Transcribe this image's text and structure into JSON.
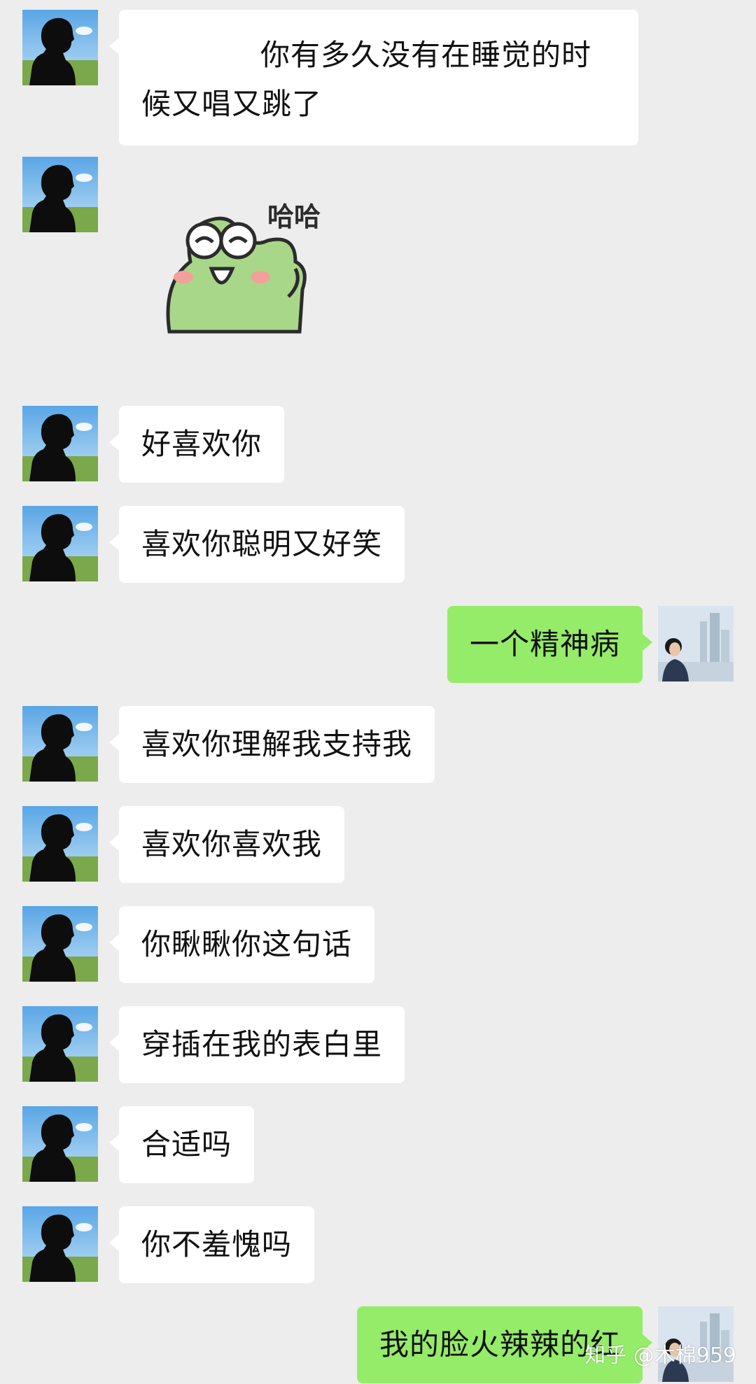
{
  "messages": [
    {
      "side": "in",
      "type": "text",
      "text": "你有多久没有在睡觉的时候又唱又跳了"
    },
    {
      "side": "in",
      "type": "sticker",
      "text": "哈哈"
    },
    {
      "side": "in",
      "type": "text",
      "text": "好喜欢你"
    },
    {
      "side": "in",
      "type": "text",
      "text": "喜欢你聪明又好笑"
    },
    {
      "side": "out",
      "type": "text",
      "text": "一个精神病"
    },
    {
      "side": "in",
      "type": "text",
      "text": "喜欢你理解我支持我"
    },
    {
      "side": "in",
      "type": "text",
      "text": "喜欢你喜欢我"
    },
    {
      "side": "in",
      "type": "text",
      "text": "你瞅瞅你这句话"
    },
    {
      "side": "in",
      "type": "text",
      "text": "穿插在我的表白里"
    },
    {
      "side": "in",
      "type": "text",
      "text": "合适吗"
    },
    {
      "side": "in",
      "type": "text",
      "text": "你不羞愧吗"
    },
    {
      "side": "out",
      "type": "text",
      "text": "我的脸火辣辣的红"
    }
  ],
  "first_message_lines": [
    "你有多久没有在睡觉的时",
    "候又唱又跳了"
  ],
  "watermark": "知乎 @木棉959",
  "colors": {
    "background": "#ededed",
    "incoming_bubble": "#ffffff",
    "outgoing_bubble": "#95ec69",
    "text": "#111111"
  },
  "icons": {
    "incoming_avatar": "silhouette-avatar-icon",
    "outgoing_avatar": "girl-photo-avatar-icon",
    "sticker": "frog-laughing-sticker"
  }
}
